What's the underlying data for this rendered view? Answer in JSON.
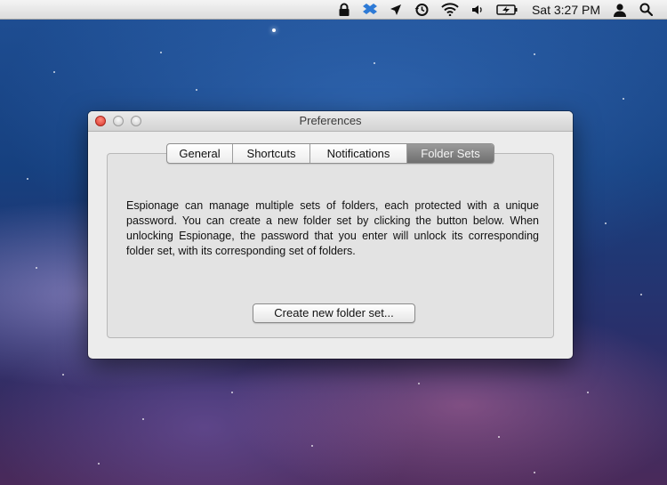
{
  "menubar": {
    "icons": [
      "lock-icon",
      "dropbox-icon",
      "location-arrow-icon",
      "time-machine-icon",
      "wifi-icon",
      "volume-icon",
      "battery-icon",
      "user-icon",
      "spotlight-search-icon"
    ],
    "clock": "Sat 3:27 PM"
  },
  "window": {
    "title": "Preferences",
    "tabs": [
      {
        "label": "General",
        "selected": false
      },
      {
        "label": "Shortcuts",
        "selected": false
      },
      {
        "label": "Notifications",
        "selected": false
      },
      {
        "label": "Folder Sets",
        "selected": true
      }
    ],
    "description": "Espionage can manage multiple sets of folders, each protected with a unique password. You can create a new folder set by clicking the button below. When unlocking Espionage, the password that you enter will unlock its corresponding folder set, with its corresponding set of folders.",
    "create_button_label": "Create new folder set..."
  },
  "colors": {
    "selected_tab": "#7f7f7f",
    "close_button": "#e0443a",
    "window_bg": "#ececec"
  }
}
